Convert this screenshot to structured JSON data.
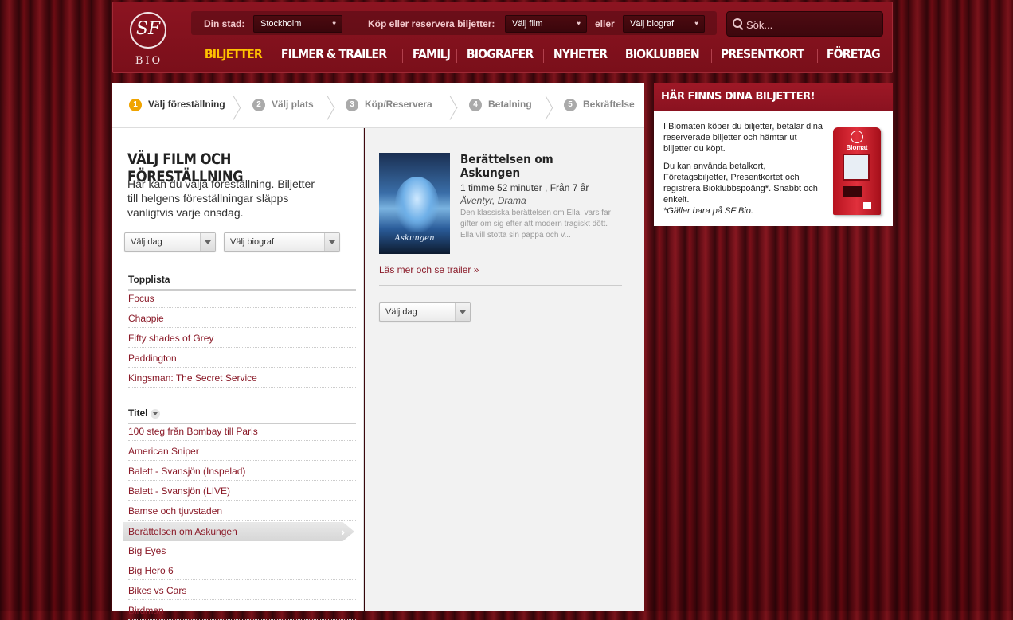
{
  "header": {
    "logo_text": "SF",
    "logo_sub": "BIO",
    "city_label": "Din stad:",
    "city_value": "Stockholm",
    "buy_label": "Köp eller reservera biljetter:",
    "film_select": "Välj film",
    "or_label": "eller",
    "cinema_select": "Välj biograf",
    "search_placeholder": "Sök...",
    "nav": [
      "BILJETTER",
      "FILMER & TRAILER",
      "FAMILJ",
      "BIOGRAFER",
      "NYHETER",
      "BIOKLUBBEN",
      "PRESENTKORT",
      "FÖRETAG"
    ],
    "nav_active_color": "#ffc200"
  },
  "steps": [
    {
      "num": "1",
      "label": "Välj föreställning"
    },
    {
      "num": "2",
      "label": "Välj plats"
    },
    {
      "num": "3",
      "label": "Köp/Reservera"
    },
    {
      "num": "4",
      "label": "Betalning"
    },
    {
      "num": "5",
      "label": "Bekräftelse"
    }
  ],
  "left": {
    "title": "VÄLJ FILM OCH FÖRESTÄLLNING",
    "intro": "Här kan du välja föreställning. Biljetter till helgens föreställningar släpps vanligtvis varje onsdag.",
    "day_select": "Välj dag",
    "cinema_select": "Välj biograf",
    "toplist_head": "Topplista",
    "toplist": [
      "Focus",
      "Chappie",
      "Fifty shades of Grey",
      "Paddington",
      "Kingsman: The Secret Service"
    ],
    "title_head": "Titel",
    "titles": [
      "100 steg från Bombay till Paris",
      "American Sniper",
      "Balett - Svansjön (Inspelad)",
      "Balett - Svansjön (LIVE)",
      "Bamse och tjuvstaden",
      "Berättelsen om Askungen",
      "Big Eyes",
      "Big Hero 6",
      "Bikes vs Cars",
      "Birdman"
    ],
    "selected_title": "Berättelsen om Askungen"
  },
  "movie": {
    "poster_title": "Askungen",
    "title": "Berättelsen om Askungen",
    "meta": "1 timme 52 minuter , Från 7 år",
    "genre": "Äventyr, Drama",
    "description": "Den klassiska berättelsen om Ella, vars far gifter om sig efter att modern tragiskt dött. Ella vill stötta sin pappa och v...",
    "read_more": "Läs mer och se trailer »",
    "day_select": "Välj dag"
  },
  "ticketbox": {
    "heading": "HÄR FINNS DINA BILJETTER!",
    "para1": "I Biomaten köper du biljetter, betalar dina reserverade biljetter och hämtar ut biljetter du köpt.",
    "para2": "Du kan använda betalkort, Företagsbiljetter, Presentkortet och registrera Bioklubbspoäng*. Snabbt och enkelt.",
    "footnote": "*Gäller bara på SF Bio.",
    "machine_label": "Biomat"
  }
}
